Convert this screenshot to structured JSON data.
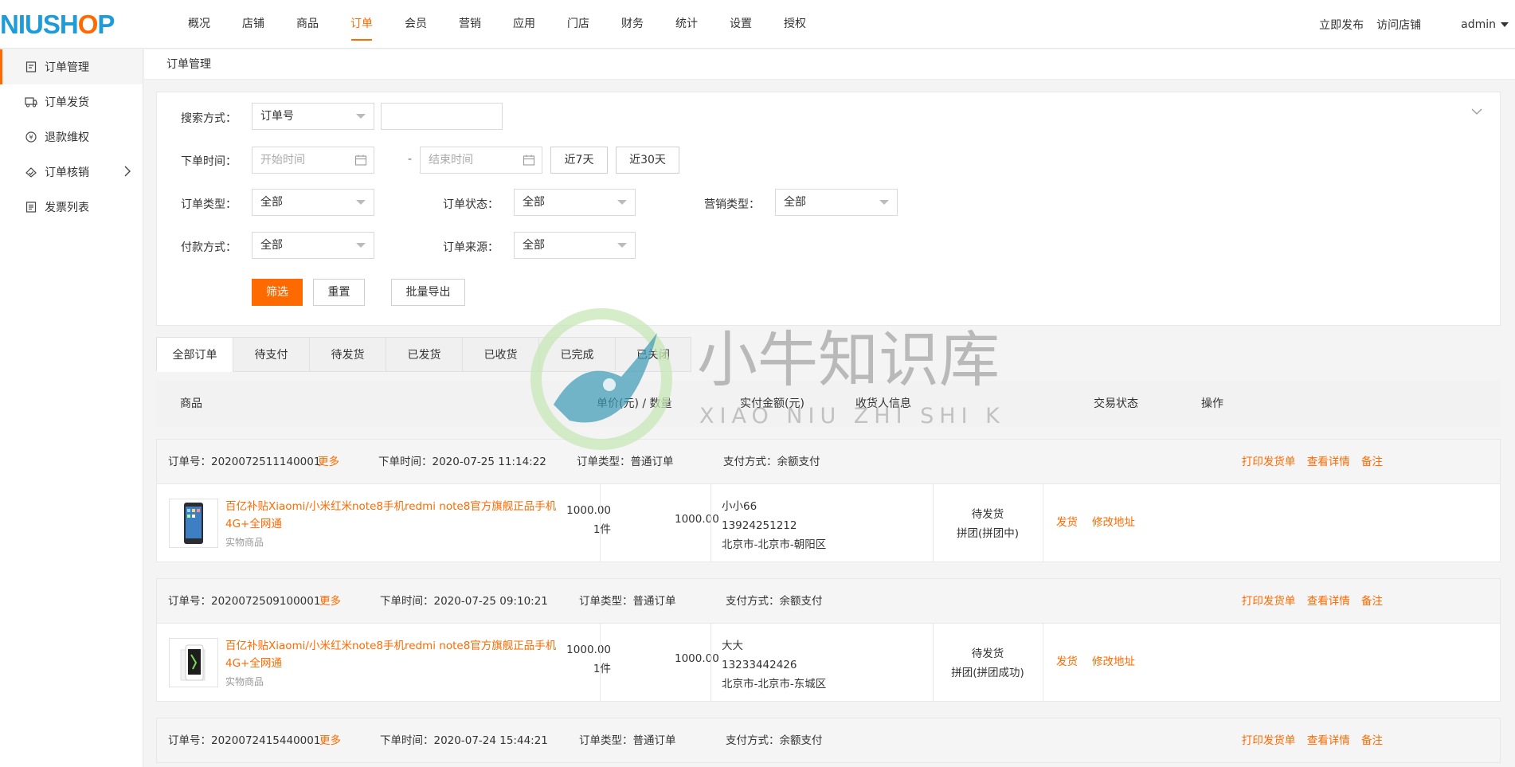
{
  "header": {
    "logo": {
      "part1": "N",
      "part2": "IUSH",
      "part3": "O",
      "part4": "P"
    },
    "nav": [
      {
        "label": "概况"
      },
      {
        "label": "店铺"
      },
      {
        "label": "商品"
      },
      {
        "label": "订单"
      },
      {
        "label": "会员"
      },
      {
        "label": "营销"
      },
      {
        "label": "应用"
      },
      {
        "label": "门店"
      },
      {
        "label": "财务"
      },
      {
        "label": "统计"
      },
      {
        "label": "设置"
      },
      {
        "label": "授权"
      }
    ],
    "active_nav": "订单",
    "publish": "立即发布",
    "visit_store": "访问店铺",
    "user": "admin"
  },
  "sidebar": {
    "items": [
      {
        "label": "订单管理",
        "icon": "document-icon"
      },
      {
        "label": "订单发货",
        "icon": "truck-icon"
      },
      {
        "label": "退款维权",
        "icon": "refund-icon"
      },
      {
        "label": "订单核销",
        "icon": "verify-icon"
      },
      {
        "label": "发票列表",
        "icon": "invoice-icon"
      }
    ]
  },
  "breadcrumb": "订单管理",
  "filter": {
    "search_label": "搜索方式：",
    "search_type": "订单号",
    "search_value": "",
    "time_label": "下单时间：",
    "start_placeholder": "开始时间",
    "end_placeholder": "结束时间",
    "dash": "-",
    "last7": "近7天",
    "last30": "近30天",
    "order_type_label": "订单类型：",
    "order_type": "全部",
    "order_status_label": "订单状态：",
    "order_status": "全部",
    "marketing_label": "营销类型：",
    "marketing": "全部",
    "pay_label": "付款方式：",
    "pay": "全部",
    "source_label": "订单来源：",
    "source": "全部",
    "filter_btn": "筛选",
    "reset_btn": "重置",
    "export_btn": "批量导出"
  },
  "tabs": [
    "全部订单",
    "待支付",
    "待发货",
    "已发货",
    "已收货",
    "已完成",
    "已关闭"
  ],
  "table_header": {
    "product": "商品",
    "price_qty": "单价(元) / 数量",
    "paid": "实付金额(元)",
    "receiver": "收货人信息",
    "status": "交易状态",
    "ops": "操作"
  },
  "orders": [
    {
      "no_label": "订单号：",
      "no": "2020072511140001",
      "more": "更多",
      "time_label": "下单时间：",
      "time": "2020-07-25 11:14:22",
      "type_label": "订单类型：",
      "type": "普通订单",
      "pay_label": "支付方式：",
      "pay": "余额支付",
      "action_print": "打印发货单",
      "action_detail": "查看详情",
      "action_note": "备注",
      "product_title": "百亿补贴Xiaomi/小米红米note8手机redmi note8官方旗舰正品手机 4G+全网通",
      "product_type": "实物商品",
      "price": "1000.00",
      "qty": "1件",
      "paid": "1000.00",
      "recv_name": "小小66",
      "recv_phone": "13924251212",
      "recv_addr": "北京市-北京市-朝阳区",
      "status": "待发货",
      "status_sub": "拼团(拼团中)",
      "op_ship": "发货",
      "op_addr": "修改地址"
    },
    {
      "no_label": "订单号：",
      "no": "2020072509100001",
      "more": "更多",
      "time_label": "下单时间：",
      "time": "2020-07-25 09:10:21",
      "type_label": "订单类型：",
      "type": "普通订单",
      "pay_label": "支付方式：",
      "pay": "余额支付",
      "action_print": "打印发货单",
      "action_detail": "查看详情",
      "action_note": "备注",
      "product_title": "百亿补贴Xiaomi/小米红米note8手机redmi note8官方旗舰正品手机 4G+全网通",
      "product_type": "实物商品",
      "price": "1000.00",
      "qty": "1件",
      "paid": "1000.00",
      "recv_name": "大大",
      "recv_phone": "13233442426",
      "recv_addr": "北京市-北京市-东城区",
      "status": "待发货",
      "status_sub": "拼团(拼团成功)",
      "op_ship": "发货",
      "op_addr": "修改地址"
    },
    {
      "no_label": "订单号：",
      "no": "2020072415440001",
      "more": "更多",
      "time_label": "下单时间：",
      "time": "2020-07-24 15:44:21",
      "type_label": "订单类型：",
      "type": "普通订单",
      "pay_label": "支付方式：",
      "pay": "余额支付",
      "action_print": "打印发货单",
      "action_detail": "查看详情",
      "action_note": "备注"
    }
  ],
  "watermark": {
    "cn": "小牛知识库",
    "en": "XIAO NIU ZHI SHI KU"
  },
  "colors": {
    "accent": "#ff6a00",
    "logo_blue": "#1f9bd8"
  }
}
